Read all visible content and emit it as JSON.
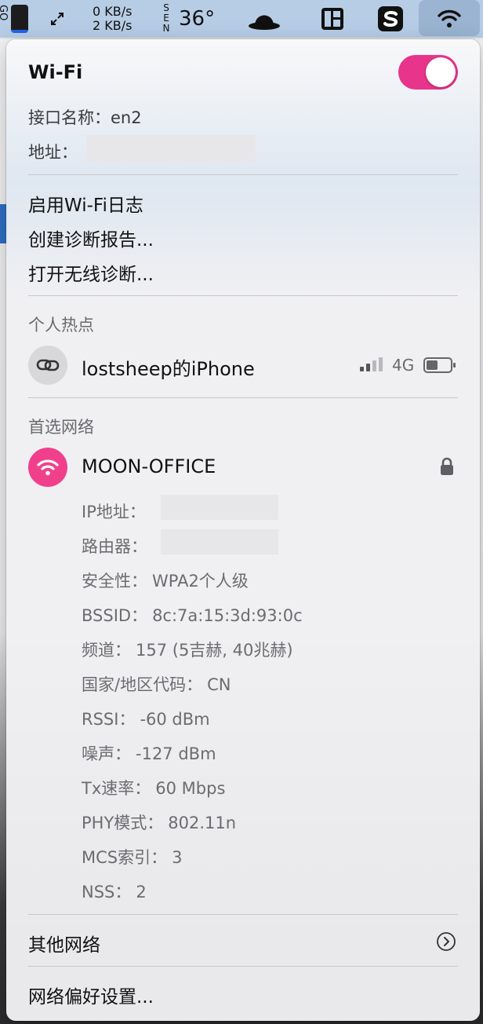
{
  "menubar": {
    "left_vertical_text": "GO",
    "net_up": "0 KB/s",
    "net_down": "2 KB/s",
    "sensor_label": "SEN",
    "temperature": "36°",
    "icons": [
      "battery-icon",
      "arrows-icon",
      "hat-icon",
      "layout-icon",
      "s-app-icon",
      "wifi-icon"
    ]
  },
  "wifi": {
    "title": "Wi-Fi",
    "enabled": true,
    "toggle_color": "#e8348b",
    "interface_label": "接口名称：",
    "interface_value": "en2",
    "address_label": "地址："
  },
  "menu": {
    "enable_log": "启用Wi-Fi日志",
    "create_report": "创建诊断报告...",
    "open_diagnostics": "打开无线诊断..."
  },
  "hotspot": {
    "heading": "个人热点",
    "device_name": "lostsheep的iPhone",
    "signal_type": "4G",
    "signal_bars_filled": 2,
    "signal_bars_total": 4
  },
  "preferred": {
    "heading": "首选网络",
    "network_name": "MOON-OFFICE",
    "accent_color": "#f0408c",
    "details": [
      {
        "label": "IP地址：",
        "value": "",
        "redacted": true
      },
      {
        "label": "路由器：",
        "value": "",
        "redacted": true
      },
      {
        "label": "安全性：",
        "value": "WPA2个人级"
      },
      {
        "label": "BSSID：",
        "value": "8c:7a:15:3d:93:0c"
      },
      {
        "label": "频道：",
        "value": "157 (5吉赫, 40兆赫)"
      },
      {
        "label": "国家/地区代码：",
        "value": "CN"
      },
      {
        "label": "RSSI：",
        "value": "-60 dBm"
      },
      {
        "label": "噪声：",
        "value": "-127 dBm"
      },
      {
        "label": "Tx速率：",
        "value": "60 Mbps"
      },
      {
        "label": "PHY模式：",
        "value": "802.11n"
      },
      {
        "label": "MCS索引：",
        "value": "3"
      },
      {
        "label": "NSS：",
        "value": "2"
      }
    ]
  },
  "other_networks": "其他网络",
  "network_prefs": "网络偏好设置..."
}
